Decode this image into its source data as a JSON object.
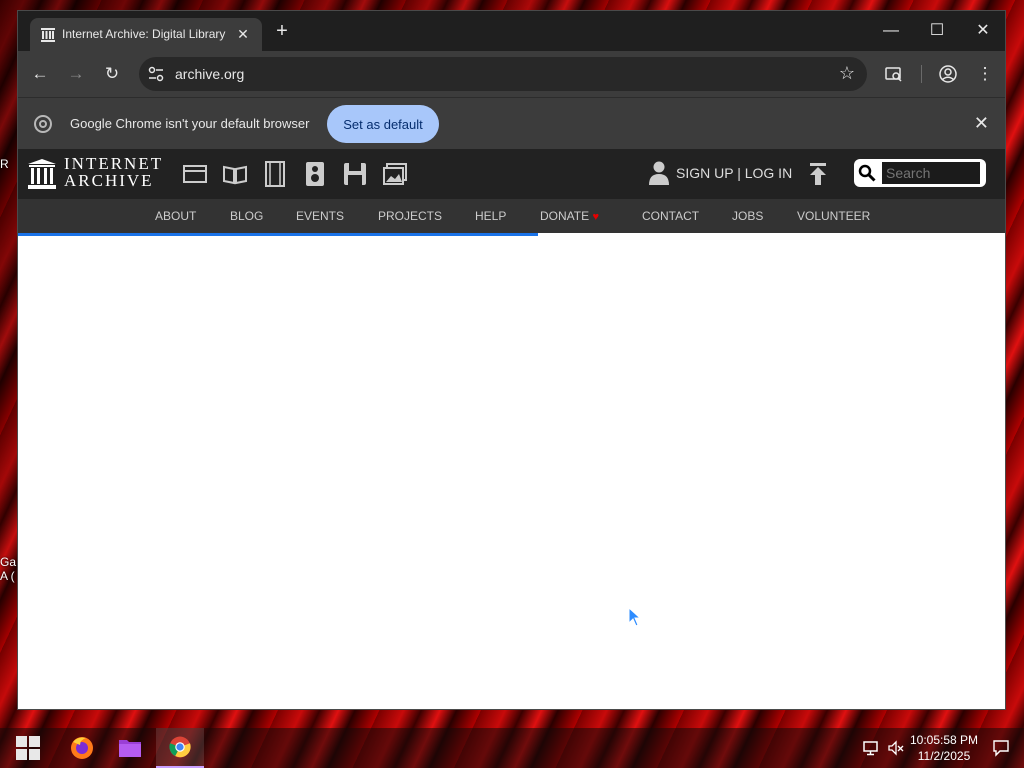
{
  "desktop": {
    "fragments": [
      "R",
      "Ga",
      "A ("
    ]
  },
  "browser": {
    "tab_title": "Internet Archive: Digital Library",
    "tab_close": "✕",
    "new_tab": "+",
    "window_controls": {
      "minimize": "—",
      "maximize": "☐",
      "close": "✕"
    },
    "toolbar": {
      "back": "←",
      "forward": "→",
      "reload": "↻"
    },
    "url": "archive.org",
    "infobar": {
      "message": "Google Chrome isn't your default browser",
      "button": "Set as default",
      "close": "✕"
    }
  },
  "ia": {
    "logo_line1": "INTERNET",
    "logo_line2": "ARCHIVE",
    "media_icons": [
      "web-icon",
      "texts-icon",
      "video-icon",
      "audio-icon",
      "software-icon",
      "images-icon"
    ],
    "signup_label": "SIGN UP | LOG IN",
    "search_placeholder": "Search",
    "nav": [
      "ABOUT",
      "BLOG",
      "EVENTS",
      "PROJECTS",
      "HELP",
      "DONATE",
      "CONTACT",
      "JOBS",
      "VOLUNTEER"
    ],
    "donate_heart": "♥"
  },
  "taskbar": {
    "time": "10:05:58 PM",
    "date": "11/2/2025"
  },
  "colors": {
    "accent": "#a8c7fa",
    "progress": "#1a73e8",
    "ia_bar": "#222222"
  }
}
